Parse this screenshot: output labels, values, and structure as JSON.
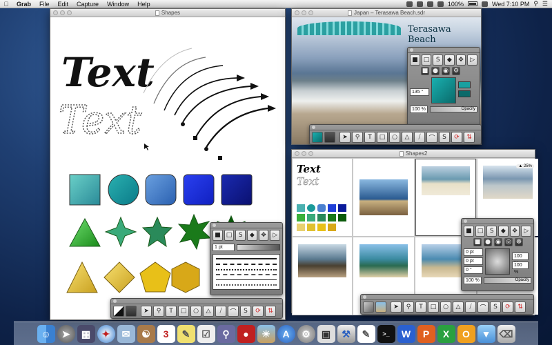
{
  "menubar": {
    "app": "Grab",
    "menus": [
      "File",
      "Edit",
      "Capture",
      "Window",
      "Help"
    ],
    "battery": "100%",
    "clock": "Wed 7:10 PM"
  },
  "windows": {
    "shapes": {
      "title": "Shapes",
      "text_solid": "Text",
      "text_outline": "Text"
    },
    "japan": {
      "title": "Japan – Terasawa Beach.sdr",
      "banner": "Terasawa Beach"
    },
    "shapes2": {
      "title": "Shapes2",
      "zoom_badge": "▲ 25%",
      "mini_text": "Text",
      "mini_text_outline": "Text"
    }
  },
  "palettes": {
    "japan_color": {
      "angle": "135 °",
      "percent": "100 %",
      "opacity_label": "Opacity"
    },
    "line": {
      "width": "1 pt"
    },
    "shapes2_color": {
      "x": "0 pt",
      "y": "0 pt",
      "angle": "0 °",
      "w": "100 %",
      "h": "100 %",
      "percent": "100 %",
      "opacity_label": "Opacity"
    }
  },
  "tools": [
    "arrow-tool",
    "zoom-tool",
    "text-tool",
    "rectangle-tool",
    "circle-tool",
    "triangle-tool",
    "line-tool",
    "arc-tool",
    "curve-tool",
    "rotate-tool",
    "transform-tool"
  ],
  "dock": [
    "finder",
    "launchpad",
    "mission-control",
    "safari",
    "mail",
    "contacts",
    "calendar",
    "notes",
    "reminders",
    "maps",
    "photobooth",
    "iphoto",
    "app-store",
    "system-preferences",
    "preview",
    "xcode",
    "terminal",
    "word",
    "powerpoint",
    "excel",
    "outlook",
    "folder",
    "trash"
  ],
  "colors": {
    "teal": "#1a9a9a",
    "blue": "#1f3fd8",
    "navy": "#0a1a9a",
    "green": "#2a9a2a",
    "gold": "#e0c030"
  }
}
